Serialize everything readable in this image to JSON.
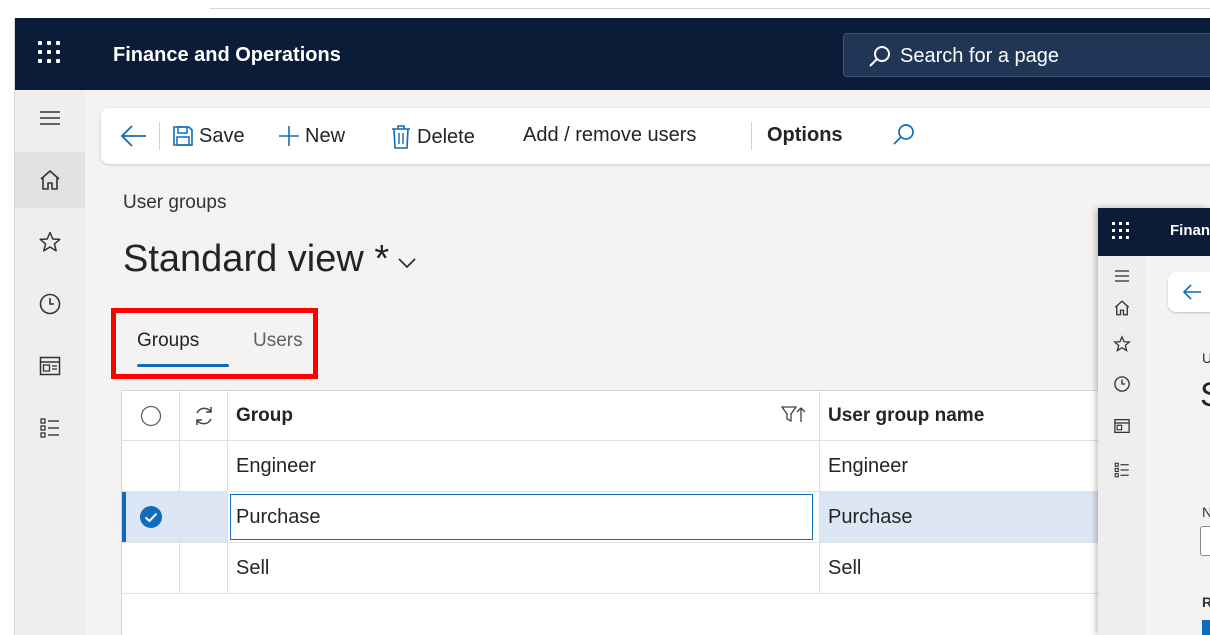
{
  "app": {
    "title": "Finance and Operations"
  },
  "search": {
    "placeholder": "Search for a page"
  },
  "nav": {
    "items": [
      {
        "icon": "hamburger-icon"
      },
      {
        "icon": "home-icon"
      },
      {
        "icon": "star-icon"
      },
      {
        "icon": "clock-icon"
      },
      {
        "icon": "workspace-icon"
      },
      {
        "icon": "modules-list-icon"
      }
    ]
  },
  "toolbar": {
    "save_label": "Save",
    "new_label": "New",
    "delete_label": "Delete",
    "add_remove_label": "Add / remove users",
    "options_label": "Options"
  },
  "page": {
    "breadcrumb": "User groups",
    "view_title": "Standard view *"
  },
  "tabs": [
    {
      "label": "Groups",
      "active": true
    },
    {
      "label": "Users",
      "active": false
    }
  ],
  "grid": {
    "columns": [
      "Group",
      "User group name"
    ],
    "rows": [
      {
        "group": "Engineer",
        "name": "Engineer",
        "selected": false
      },
      {
        "group": "Purchase",
        "name": "Purchase",
        "selected": true
      },
      {
        "group": "Sell",
        "name": "Sell",
        "selected": false
      }
    ]
  },
  "panel": {
    "title": "Finance and Operations",
    "letter_u": "U",
    "letter_s": "S",
    "letter_n": "N",
    "letter_r": "R"
  },
  "colors": {
    "topbar": "#0b1c38",
    "accent": "#0f6cbd",
    "highlight": "#ff0000",
    "selected_row": "#dce6f5"
  }
}
